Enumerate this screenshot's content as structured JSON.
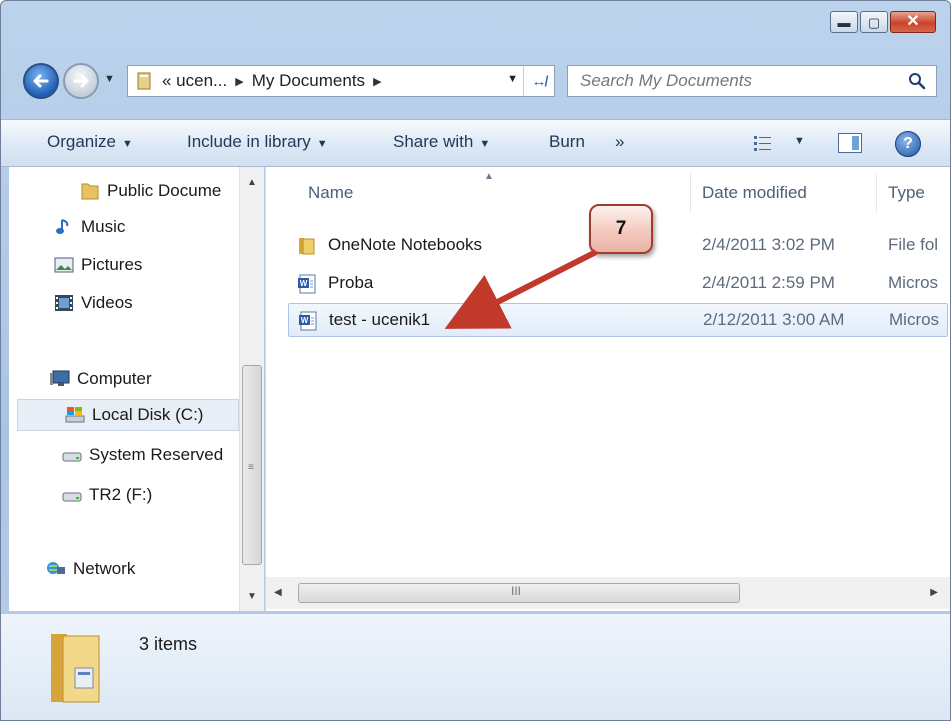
{
  "window": {
    "caption_buttons": {
      "minimize": "minimize-icon",
      "maximize": "maximize-icon",
      "close": "close-icon"
    }
  },
  "nav": {
    "breadcrumb": [
      "« ucen...",
      "My Documents"
    ],
    "search_placeholder": "Search My Documents"
  },
  "toolbar": {
    "organize": "Organize",
    "include_in_library": "Include in library",
    "share_with": "Share with",
    "burn": "Burn",
    "more": "»"
  },
  "sidebar": {
    "items": [
      {
        "label": "Public Docume",
        "icon": "folder-icon"
      },
      {
        "label": "Music",
        "icon": "music-icon"
      },
      {
        "label": "Pictures",
        "icon": "pictures-icon"
      },
      {
        "label": "Videos",
        "icon": "videos-icon"
      },
      {
        "label": "Computer",
        "icon": "computer-icon"
      },
      {
        "label": "Local Disk (C:)",
        "icon": "local-disk-icon",
        "selected": true
      },
      {
        "label": "System Reserved",
        "icon": "drive-icon"
      },
      {
        "label": "TR2 (F:)",
        "icon": "drive-icon"
      },
      {
        "label": "Network",
        "icon": "network-icon"
      }
    ]
  },
  "file_list": {
    "columns": [
      "Name",
      "Date modified",
      "Type"
    ],
    "rows": [
      {
        "name": "OneNote Notebooks",
        "date": "2/4/2011 3:02 PM",
        "type": "File fol",
        "icon": "folder-icon"
      },
      {
        "name": "Proba",
        "date": "2/4/2011 2:59 PM",
        "type": "Micros",
        "icon": "word-doc-icon"
      },
      {
        "name": "test - ucenik1",
        "date": "2/12/2011 3:00 AM",
        "type": "Micros",
        "icon": "word-doc-icon",
        "selected": true
      }
    ],
    "hscroll_grip": "III"
  },
  "details": {
    "count": "3 items"
  },
  "annotation": {
    "number": "7",
    "color": "#c0392b"
  }
}
